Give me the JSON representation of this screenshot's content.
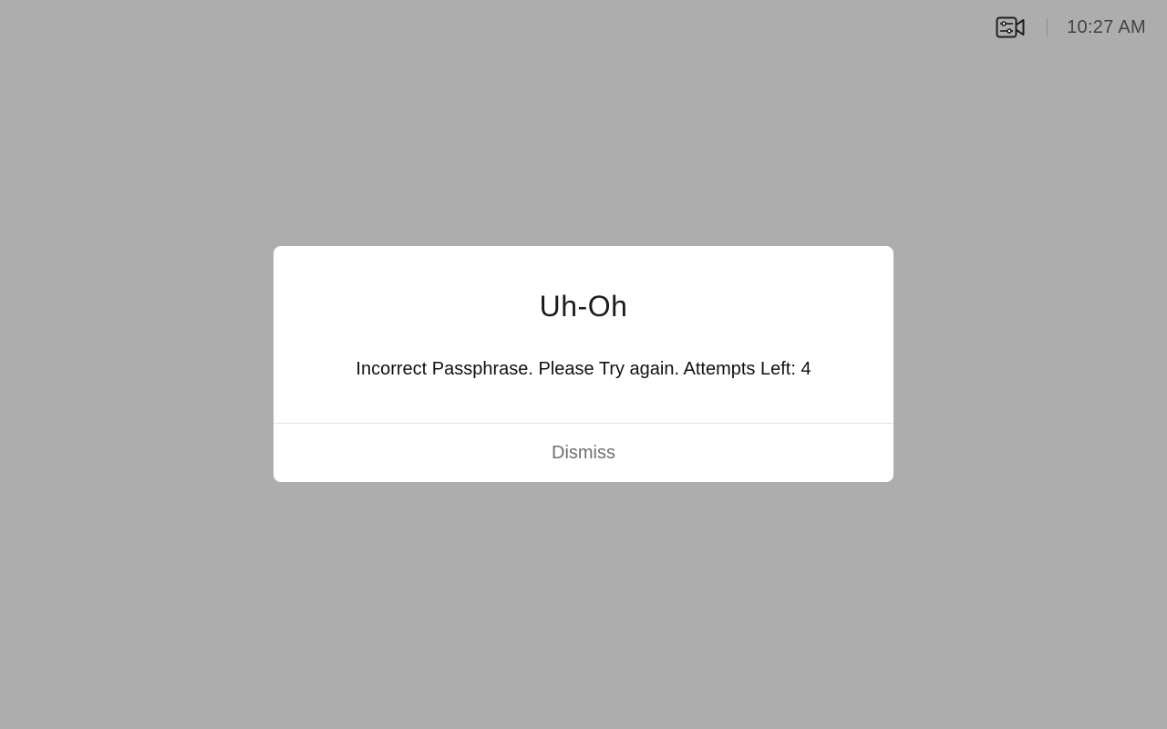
{
  "status_bar": {
    "camera_icon": "camera-settings-icon",
    "time": "10:27 AM"
  },
  "dialog": {
    "title": "Uh-Oh",
    "message": "Incorrect Passphrase. Please Try again. Attempts Left: 4",
    "dismiss_label": "Dismiss"
  },
  "colors": {
    "backdrop": "#adadad",
    "dialog_bg": "#ffffff",
    "dismiss_text": "#707070"
  }
}
